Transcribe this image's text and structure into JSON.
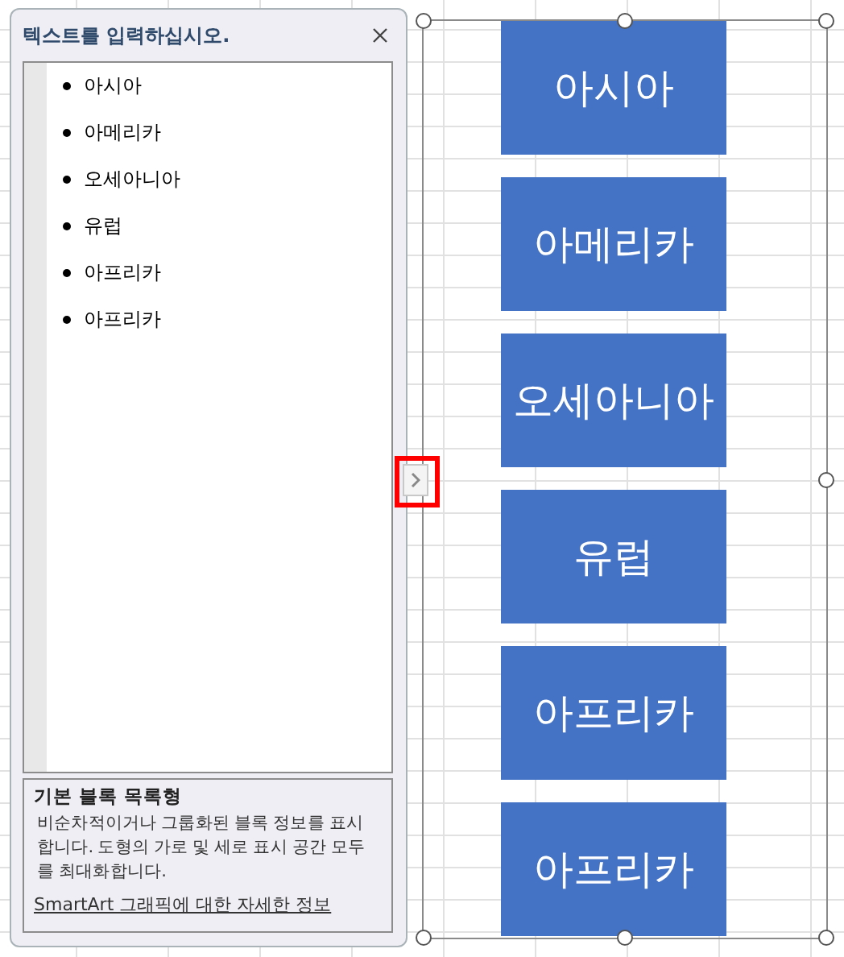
{
  "text_pane": {
    "title": "텍스트를 입력하십시오.",
    "items": [
      {
        "text": "아시아"
      },
      {
        "text": "아메리카"
      },
      {
        "text": "오세아니아"
      },
      {
        "text": "유럽"
      },
      {
        "text": "아프리카"
      },
      {
        "text": "아프리카"
      }
    ],
    "description": {
      "heading": "기본 블록 목록형",
      "body": "비순차적이거나 그룹화된 블록 정보를 표시합니다. 도형의 가로 및 세로 표시 공간 모두를 최대화합니다.",
      "link": "SmartArt 그래픽에 대한 자세한 정보"
    }
  },
  "smartart": {
    "blocks": [
      {
        "text": "아시아"
      },
      {
        "text": "아메리카"
      },
      {
        "text": "오세아니아"
      },
      {
        "text": "유럽"
      },
      {
        "text": "아프리카"
      },
      {
        "text": "아프리카"
      }
    ]
  }
}
